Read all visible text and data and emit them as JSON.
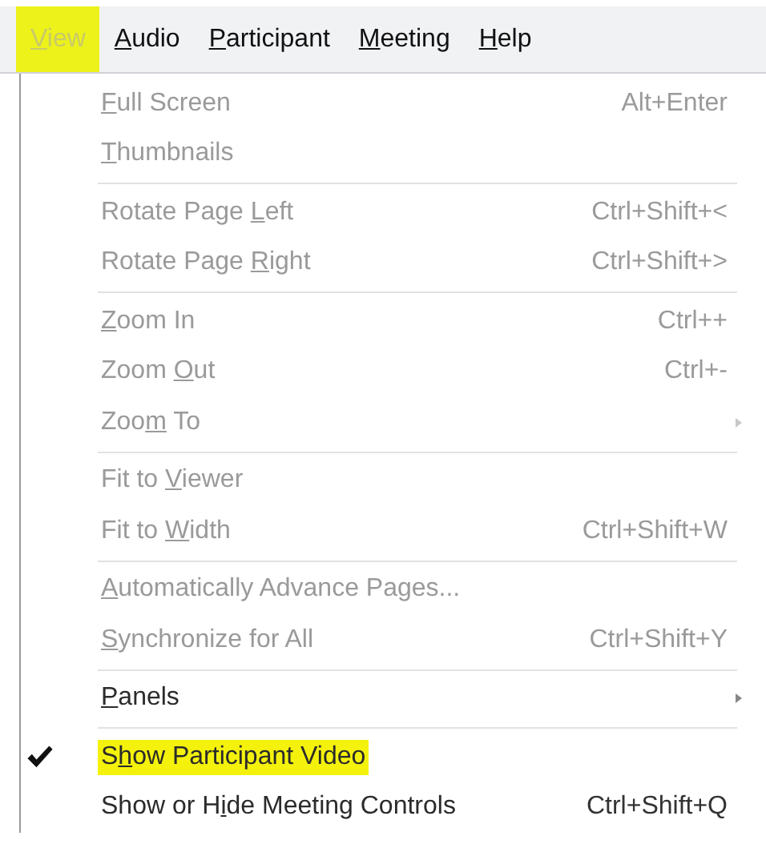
{
  "menu_bar": [
    {
      "label": {
        "key": "V",
        "after": "iew"
      },
      "selected": true
    },
    {
      "label": {
        "key": "A",
        "after": "udio"
      },
      "selected": false
    },
    {
      "label": {
        "key": "P",
        "after": "articipant"
      },
      "selected": false
    },
    {
      "label": {
        "key": "M",
        "after": "eeting"
      },
      "selected": false
    },
    {
      "label": {
        "key": "H",
        "after": "elp"
      },
      "selected": false
    }
  ],
  "menu": {
    "groups": [
      [
        {
          "label": {
            "key": "F",
            "after": "ull Screen"
          },
          "shortcut": "Alt+Enter",
          "disabled": true,
          "checked": false,
          "highlighted": false,
          "submenu": false
        },
        {
          "label": {
            "key": "T",
            "after": "humbnails"
          },
          "disabled": true,
          "checked": false,
          "highlighted": false,
          "submenu": false
        }
      ],
      [
        {
          "label": {
            "before": "Rotate Page ",
            "key": "L",
            "after": "eft"
          },
          "shortcut": "Ctrl+Shift+<",
          "disabled": true,
          "checked": false,
          "highlighted": false,
          "submenu": false
        },
        {
          "label": {
            "before": "Rotate Page ",
            "key": "R",
            "after": "ight"
          },
          "shortcut": "Ctrl+Shift+>",
          "disabled": true,
          "checked": false,
          "highlighted": false,
          "submenu": false
        }
      ],
      [
        {
          "label": {
            "key": "Z",
            "after": "oom In"
          },
          "shortcut": "Ctrl++",
          "disabled": true,
          "checked": false,
          "highlighted": false,
          "submenu": false
        },
        {
          "label": {
            "before": "Zoom ",
            "key": "O",
            "after": "ut"
          },
          "shortcut": "Ctrl+-",
          "disabled": true,
          "checked": false,
          "highlighted": false,
          "submenu": false
        },
        {
          "label": {
            "before": "Zoo",
            "key": "m",
            "after": " To"
          },
          "disabled": true,
          "checked": false,
          "highlighted": false,
          "submenu": true
        }
      ],
      [
        {
          "label": {
            "before": "Fit to ",
            "key": "V",
            "after": "iewer"
          },
          "disabled": true,
          "checked": false,
          "highlighted": false,
          "submenu": false
        },
        {
          "label": {
            "before": "Fit to ",
            "key": "W",
            "after": "idth"
          },
          "shortcut": "Ctrl+Shift+W",
          "disabled": true,
          "checked": false,
          "highlighted": false,
          "submenu": false
        }
      ],
      [
        {
          "label": {
            "key": "A",
            "after": "utomatically Advance Pages..."
          },
          "disabled": true,
          "checked": false,
          "highlighted": false,
          "submenu": false
        },
        {
          "label": {
            "key": "S",
            "after": "ynchronize for All"
          },
          "shortcut": "Ctrl+Shift+Y",
          "disabled": true,
          "checked": false,
          "highlighted": false,
          "submenu": false
        }
      ],
      [
        {
          "label": {
            "key": "P",
            "after": "anels"
          },
          "disabled": false,
          "checked": false,
          "highlighted": false,
          "submenu": true
        }
      ],
      [
        {
          "label": {
            "before": "S",
            "key": "h",
            "after": "ow Participant Video"
          },
          "disabled": false,
          "checked": true,
          "highlighted": true,
          "submenu": false
        },
        {
          "label": {
            "before": "Show or H",
            "key": "i",
            "after": "de Meeting Controls"
          },
          "shortcut": "Ctrl+Shift+Q",
          "disabled": false,
          "checked": false,
          "highlighted": false,
          "submenu": false
        }
      ]
    ]
  }
}
